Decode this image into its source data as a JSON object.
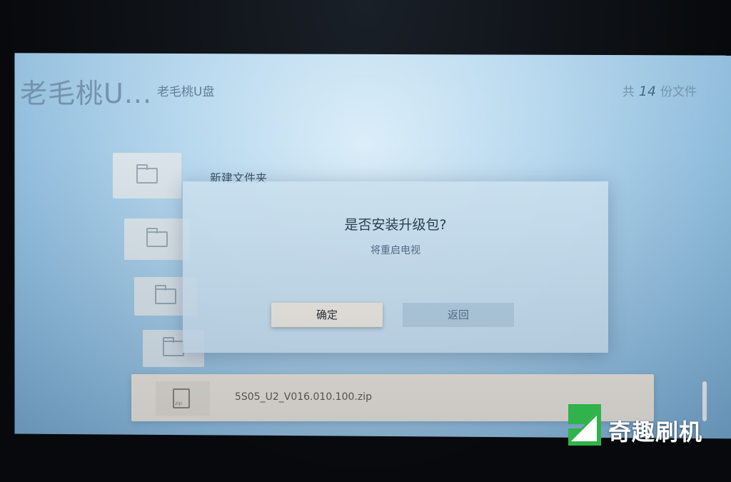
{
  "header": {
    "title": "老毛桃U...",
    "subtitle": "老毛桃U盘",
    "count_prefix": "共",
    "count": "14",
    "count_suffix": "份文件"
  },
  "file_list": {
    "items": [
      {
        "label": "新建文件夹",
        "icon": "folder-icon"
      },
      {
        "label": "",
        "icon": "folder-icon"
      },
      {
        "label": "",
        "icon": "folder-icon"
      },
      {
        "label": "",
        "icon": "folder-icon"
      }
    ],
    "selected": {
      "label": "5S05_U2_V016.010.100.zip",
      "icon": "zip-file-icon"
    }
  },
  "dialog": {
    "title": "是否安装升级包?",
    "message": "将重启电视",
    "confirm_label": "确定",
    "back_label": "返回"
  },
  "watermark": {
    "text": "奇趣刷机",
    "colors": {
      "green": "#2fb34a",
      "white": "#ffffff"
    }
  }
}
